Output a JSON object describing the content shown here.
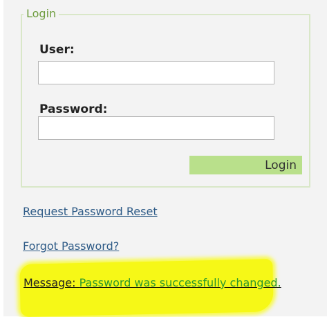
{
  "login": {
    "legend": "Login",
    "user_label": "User:",
    "user_value": "",
    "password_label": "Password:",
    "password_value": "",
    "submit_label": "Login"
  },
  "links": {
    "request_reset": "Request Password Reset",
    "forgot_password": "Forgot Password?"
  },
  "message": {
    "label": "Message:",
    "text": "Password was successfully changed."
  },
  "colors": {
    "legend": "#6d9c3d",
    "button": "#b9e08b",
    "link": "#2d5a86",
    "message_text": "#2c9a2c",
    "highlight": "#f6f817"
  }
}
